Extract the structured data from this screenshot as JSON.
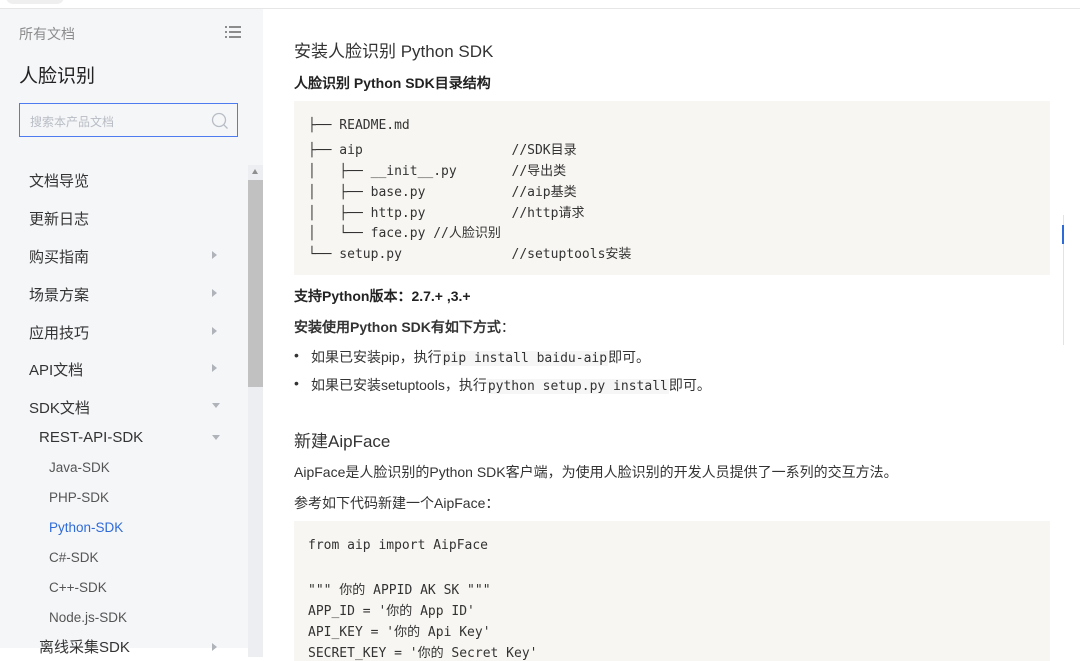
{
  "sidebar": {
    "header": "所有文档",
    "title": "人脸识别",
    "search_placeholder": "搜索本产品文档",
    "items": [
      {
        "label": "文档导览"
      },
      {
        "label": "更新日志"
      },
      {
        "label": "购买指南"
      },
      {
        "label": "场景方案"
      },
      {
        "label": "应用技巧"
      },
      {
        "label": "API文档"
      },
      {
        "label": "SDK文档"
      },
      {
        "label": "REST-API-SDK"
      },
      {
        "label": "Java-SDK"
      },
      {
        "label": "PHP-SDK"
      },
      {
        "label": "Python-SDK"
      },
      {
        "label": "C#-SDK"
      },
      {
        "label": "C++-SDK"
      },
      {
        "label": "Node.js-SDK"
      },
      {
        "label": "离线采集SDK"
      }
    ]
  },
  "main": {
    "section1_title": "安装人脸识别 Python SDK",
    "dir_heading": "人脸识别 Python SDK目录结构",
    "dir_lines": [
      "├── README.md",
      "├── aip                   //SDK目录",
      "│   ├── __init__.py       //导出类",
      "│   ├── base.py           //aip基类",
      "│   ├── http.py           //http请求",
      "│   └── face.py //人脸识别",
      "└── setup.py              //setuptools安装"
    ],
    "version_line": "支持Python版本：2.7.+ ,3.+",
    "install_heading_bold": "安装使用Python SDK有如下方式",
    "install_heading_tail": "：",
    "bullet1_pre": "如果已安装pip，执行",
    "bullet1_code": "pip install baidu-aip",
    "bullet1_post": "即可。",
    "bullet2_pre": "如果已安装setuptools，执行",
    "bullet2_code": "python setup.py install",
    "bullet2_post": "即可。",
    "section2_title": "新建AipFace",
    "desc": "AipFace是人脸识别的Python SDK客户端，为使用人脸识别的开发人员提供了一系列的交互方法。",
    "ref": "参考如下代码新建一个AipFace：",
    "code_lines": [
      "from aip import AipFace",
      "",
      "\"\"\" 你的 APPID AK SK \"\"\"",
      "APP_ID = '你的 App ID'",
      "API_KEY = '你的 Api Key'",
      "SECRET_KEY = '你的 Secret Key'"
    ]
  }
}
